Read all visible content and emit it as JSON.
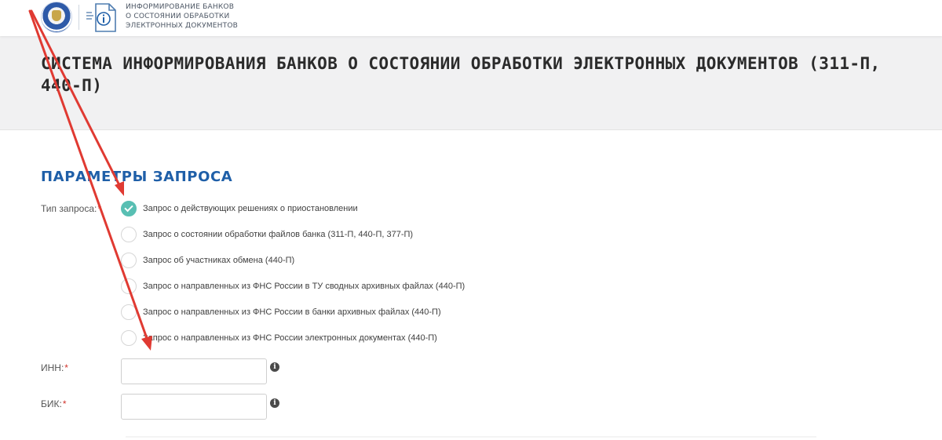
{
  "header": {
    "logo_lines": [
      "ИНФОРМИРОВАНИЕ БАНКОВ",
      "О СОСТОЯНИИ ОБРАБОТКИ",
      "ЭЛЕКТРОННЫХ ДОКУМЕНТОВ"
    ]
  },
  "page": {
    "title": "СИСТЕМА ИНФОРМИРОВАНИЯ БАНКОВ О СОСТОЯНИИ ОБРАБОТКИ ЭЛЕКТРОННЫХ ДОКУМЕНТОВ (311-П, 440-П)"
  },
  "form": {
    "section_title": "ПАРАМЕТРЫ ЗАПРОСА",
    "request_type_label": "Тип запроса:",
    "request_type_required": "*",
    "options": [
      {
        "label": "Запрос о действующих решениях о приостановлении",
        "checked": true
      },
      {
        "label": "Запрос о состоянии обработки файлов банка (311-П, 440-П, 377-П)",
        "checked": false
      },
      {
        "label": "Запрос об участниках обмена (440-П)",
        "checked": false
      },
      {
        "label": "Запрос о направленных из ФНС России в ТУ сводных архивных файлах (440-П)",
        "checked": false
      },
      {
        "label": "Запрос о направленных из ФНС России в банки архивных файлах (440-П)",
        "checked": false
      },
      {
        "label": "Запрос о направленных из ФНС России электронных документах (440-П)",
        "checked": false
      }
    ],
    "inn_label": "ИНН:",
    "inn_required": "*",
    "inn_value": "",
    "bik_label": "БИК:",
    "bik_required": "*",
    "bik_value": "",
    "info_glyph": "i"
  },
  "colors": {
    "accent": "#1f5fa8",
    "radio_checked": "#58bfb3",
    "required": "#d0342c",
    "annotation_arrow": "#e03a32"
  },
  "icons": [
    "emblem-icon",
    "document-info-icon",
    "check-icon",
    "info-icon"
  ]
}
